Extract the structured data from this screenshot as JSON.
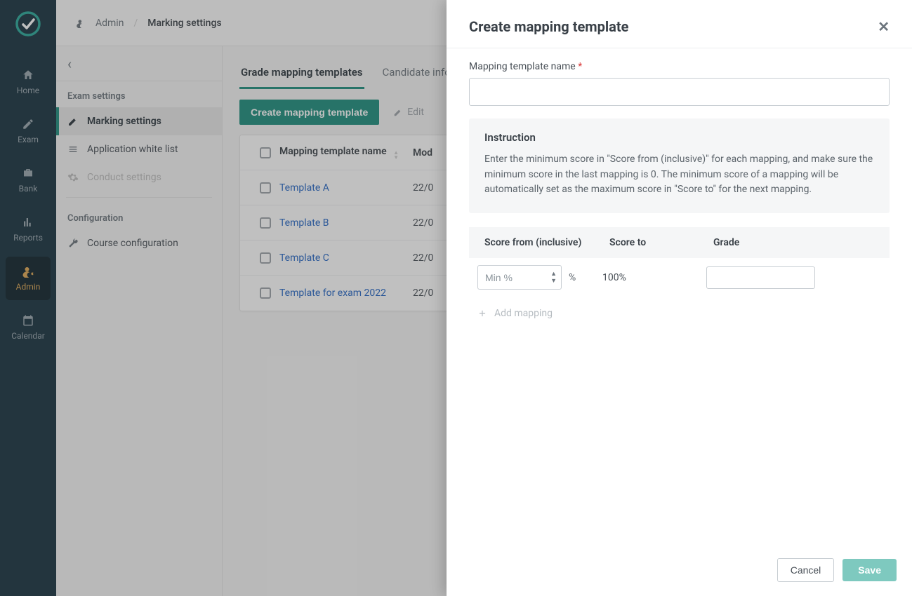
{
  "nav": {
    "items": [
      {
        "label": "Home"
      },
      {
        "label": "Exam"
      },
      {
        "label": "Bank"
      },
      {
        "label": "Reports"
      },
      {
        "label": "Admin"
      },
      {
        "label": "Calendar"
      }
    ]
  },
  "breadcrumb": {
    "root": "Admin",
    "current": "Marking settings"
  },
  "sidebar": {
    "section1": "Exam settings",
    "items1": [
      {
        "label": "Marking settings"
      },
      {
        "label": "Application white list"
      },
      {
        "label": "Conduct settings"
      }
    ],
    "section2": "Configuration",
    "items2": [
      {
        "label": "Course configuration"
      }
    ]
  },
  "tabs": [
    {
      "label": "Grade mapping templates"
    },
    {
      "label": "Candidate info"
    }
  ],
  "toolbar": {
    "create": "Create mapping template",
    "edit": "Edit"
  },
  "table": {
    "cols": {
      "name": "Mapping template name",
      "mod": "Mod"
    },
    "rows": [
      {
        "name": "Template A",
        "mod": "22/0"
      },
      {
        "name": "Template B",
        "mod": "22/0"
      },
      {
        "name": "Template C",
        "mod": "22/0"
      },
      {
        "name": "Template for exam 2022",
        "mod": "22/0"
      }
    ]
  },
  "drawer": {
    "title": "Create mapping template",
    "name_label": "Mapping template name",
    "instruction_title": "Instruction",
    "instruction_body": "Enter the minimum score in \"Score from (inclusive)\" for each mapping, and make sure the minimum score in the last mapping is 0. The minimum score of a mapping will be automatically set as the maximum score in \"Score to\" for the next mapping.",
    "cols": {
      "from": "Score from (inclusive)",
      "to": "Score to",
      "grade": "Grade"
    },
    "row": {
      "from_placeholder": "Min %",
      "pct": "%",
      "to": "100%"
    },
    "add": "Add mapping",
    "cancel": "Cancel",
    "save": "Save"
  }
}
